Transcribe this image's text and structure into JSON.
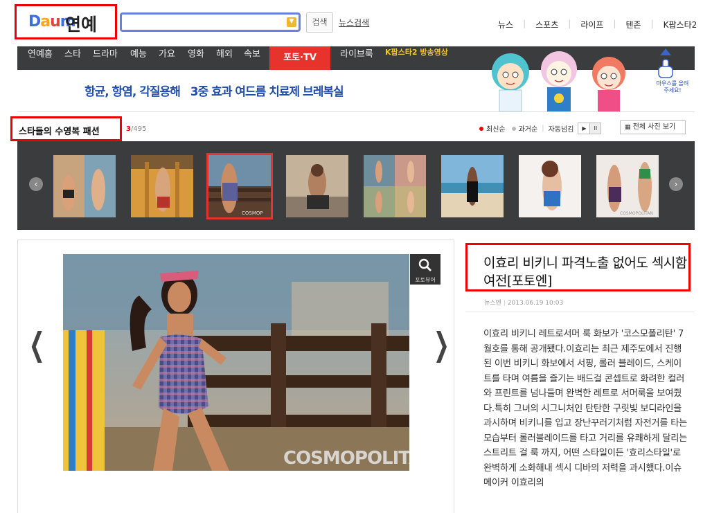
{
  "header": {
    "logo_daum": "Daum",
    "logo_section": "연예",
    "search_value": "",
    "search_button": "검색",
    "news_search": "뉴스검색",
    "top_nav": [
      "뉴스",
      "스포츠",
      "라이프",
      "텐존",
      "K팝스타2"
    ]
  },
  "gnb": {
    "items": [
      "연예홈",
      "스타",
      "드라마",
      "예능",
      "가요",
      "영화",
      "해외",
      "속보"
    ],
    "photo_tv": "포토·TV",
    "live_brook": "라이브룩",
    "kpop_video": "K팝스타2 방송영상"
  },
  "banner": {
    "text_a": "항균, 항염, 각질용해",
    "text_b": "3중 효과 여드름 치료제 브레복실",
    "mouse_hint": "마우스를 올려주세요!"
  },
  "gallery": {
    "title": "스타들의 수영복 패션",
    "current": "3",
    "total": "/495",
    "sort_latest": "최신순",
    "sort_past": "과거순",
    "auto_flip": "자동넘김",
    "play_icon": "▶",
    "pause_icon": "II",
    "all_photos": "전체 사진 보기",
    "selected_index": 3
  },
  "viewer": {
    "label": "포토뷰어"
  },
  "photo": {
    "watermark": "COSMOPOLITAN",
    "thumb_watermark": "COSMOPOLITAN"
  },
  "article": {
    "title": "이효리 비키니 파격노출 없어도 섹시함 여전[포토엔]",
    "source": "뉴스엔",
    "date": "2013.06.19 10:03",
    "body": "이효리 비키니 레트로서머 룩 화보가 '코스모폴리탄' 7월호를 통해 공개됐다.이효리는 최근 제주도에서 진행된 이번 비키니 화보에서 서핑, 롤러 블레이드, 스케이트를 타며 여름을 즐기는 배드걸 콘셉트로 화려한 컬러와 프린트를 넘나들며 완벽한 레트로 서머룩을 보여줬다.특히 그녀의 시그니처인 탄탄한 구릿빛 보디라인을과시하며 비키니를 입고 장난꾸러기처럼 자전거를 타는 모습부터 롤러블레이드를 타고 거리를 유쾌하게 달리는 스트리트 걸 룩 까지, 어떤 스타일이든 '효리스타일'로 완벽하게 소화해내 섹시 디바의 저력을 과시했다.이슈 메이커 이효리의"
  },
  "colors": {
    "accent_red": "#e8322c",
    "gnb_bg": "#3a3c3e",
    "banner_blue": "#1f4da8"
  }
}
